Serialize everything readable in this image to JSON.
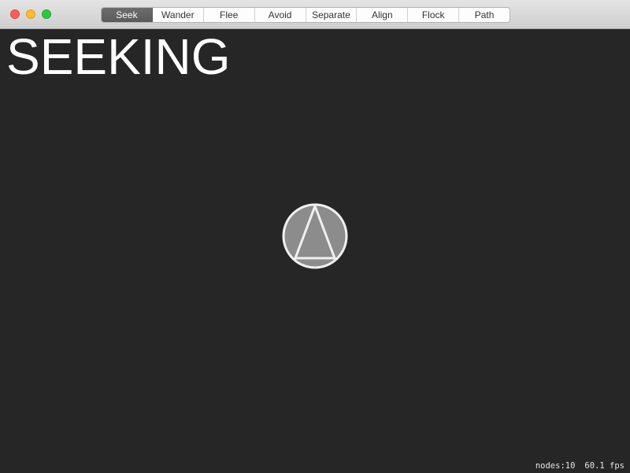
{
  "window": {
    "buttons": [
      "close",
      "minimize",
      "zoom"
    ]
  },
  "toolbar": {
    "selected": "Seek",
    "segments": [
      "Seek",
      "Wander",
      "Flee",
      "Avoid",
      "Separate",
      "Align",
      "Flock",
      "Path"
    ]
  },
  "scene": {
    "mode_label": "SEEKING",
    "background_color": "#262626",
    "agent": {
      "shape": "triangle-in-circle",
      "fill": "#8c8c8c",
      "stroke": "#f0f0f0"
    }
  },
  "stats": {
    "nodes": "nodes:10",
    "fps": "60.1 fps"
  }
}
